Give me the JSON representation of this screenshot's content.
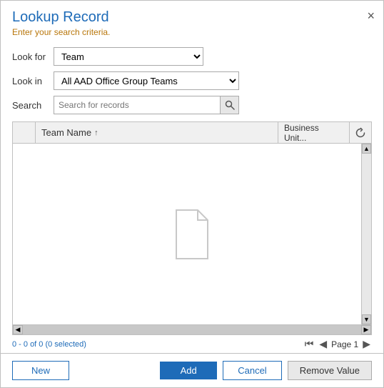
{
  "dialog": {
    "title": "Lookup Record",
    "subtitle": "Enter your search criteria.",
    "close_label": "×"
  },
  "form": {
    "look_for_label": "Look for",
    "look_in_label": "Look in",
    "search_label": "Search",
    "look_for_value": "Team",
    "look_in_value": "All AAD Office Group Teams",
    "search_placeholder": "Search for records",
    "look_for_options": [
      "Team"
    ],
    "look_in_options": [
      "All AAD Office Group Teams"
    ]
  },
  "table": {
    "col_team_name": "Team Name",
    "col_business_unit": "Business Unit...",
    "sort_arrow": "↑",
    "empty_message": ""
  },
  "status": {
    "record_count": "0 - 0 of 0 (0 selected)",
    "page_label": "Page 1"
  },
  "footer": {
    "new_label": "New",
    "add_label": "Add",
    "cancel_label": "Cancel",
    "remove_label": "Remove Value"
  }
}
